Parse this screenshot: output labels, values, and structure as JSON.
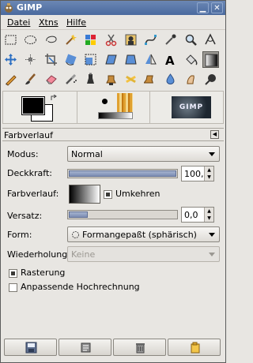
{
  "window": {
    "title": "GIMP"
  },
  "menubar": {
    "items": [
      {
        "label": "Datei",
        "mnemonic_index": 0
      },
      {
        "label": "Xtns",
        "mnemonic_index": 0
      },
      {
        "label": "Hilfe",
        "mnemonic_index": 0
      }
    ]
  },
  "toolbox": {
    "rows": [
      [
        "rect-select-icon",
        "ellipse-select-icon",
        "lasso-select-icon",
        "fuzzy-select-icon",
        "select-by-color-icon",
        "scissors-select-icon",
        "foreground-select-icon",
        "paths-icon",
        "color-picker-icon",
        "zoom-icon",
        "measure-icon"
      ],
      [
        "move-icon",
        "align-icon",
        "crop-icon",
        "rotate-icon",
        "scale-icon",
        "shear-icon",
        "perspective-icon",
        "flip-icon",
        "text-icon",
        "bucket-fill-icon",
        "blend-icon"
      ],
      [
        "pencil-icon",
        "paintbrush-icon",
        "eraser-icon",
        "airbrush-icon",
        "ink-icon",
        "clone-icon",
        "heal-icon",
        "perspective-clone-icon",
        "blur-icon",
        "smudge-icon",
        "dodge-burn-icon"
      ]
    ],
    "selected": "blend-icon"
  },
  "swatches": {
    "foreground": "#000000",
    "background": "#ffffff",
    "image_label": "GIMP"
  },
  "tool_options": {
    "title": "Farbverlauf",
    "mode_label": "Modus:",
    "mode_value": "Normal",
    "opacity_label": "Deckkraft:",
    "opacity_value": "100,0",
    "opacity_fraction": 1.0,
    "gradient_label": "Farbverlauf:",
    "reverse_label": "Umkehren",
    "reverse_checked": true,
    "offset_label": "Versatz:",
    "offset_value": "0,0",
    "offset_fraction": 0.0,
    "shape_label": "Form:",
    "shape_value": "Formangepaßt (sphärisch)",
    "repeat_label": "Wiederholung:",
    "repeat_value": "Keine",
    "dither_label": "Rasterung",
    "dither_checked": true,
    "supersample_label": "Anpassende Hochrechnung",
    "supersample_checked": false
  },
  "bottom_buttons": [
    "save-options-icon",
    "restore-options-icon",
    "delete-options-icon",
    "reset-options-icon"
  ]
}
